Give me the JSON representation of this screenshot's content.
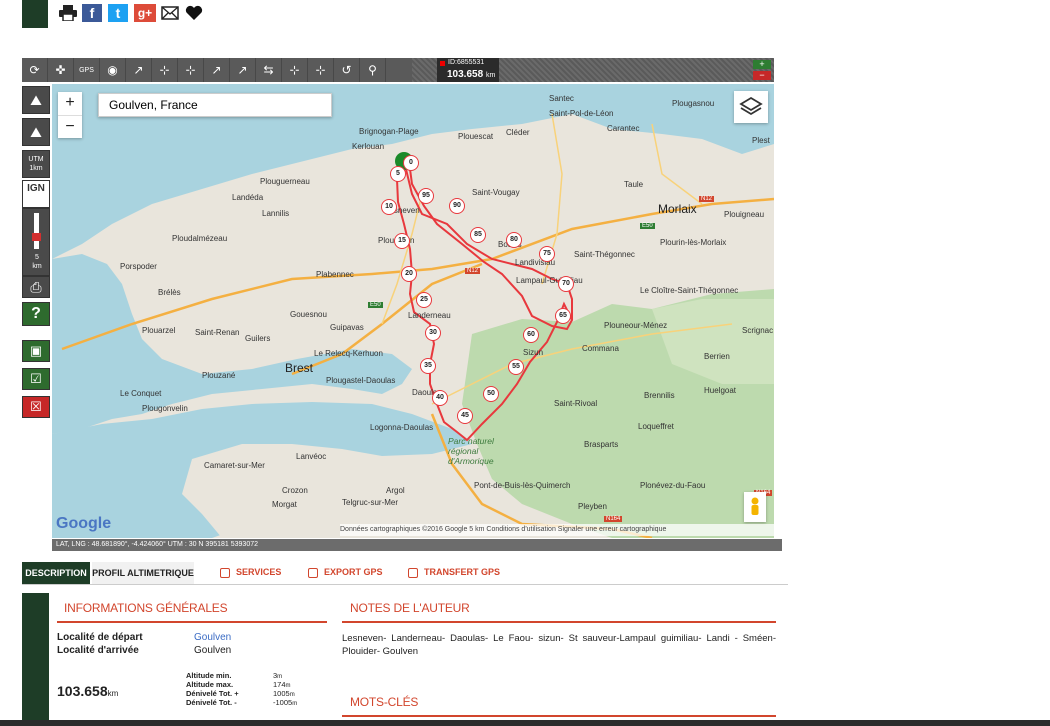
{
  "share": {
    "icons": [
      "print-icon",
      "facebook-icon",
      "twitter-icon",
      "googleplus-icon",
      "mail-icon",
      "heart-icon"
    ],
    "facebook": "f",
    "twitter": "t",
    "googleplus": "g+"
  },
  "toolbar": {
    "gps_label": "GPS",
    "route_id": "ID:6855531",
    "distance": "103.658",
    "distance_unit": "km"
  },
  "sidebar": {
    "utm_label": "UTM",
    "utm_scale": "1km",
    "ign_label": "IGN",
    "slider_scale": "5",
    "slider_unit": "km",
    "help": "?"
  },
  "map": {
    "search_value": "Goulven, France",
    "zoom_in": "+",
    "zoom_out": "−",
    "footer": "Données cartographiques ©2016 Google    5 km              Conditions d'utilisation    Signaler une erreur cartographique",
    "google": "Google",
    "coords": "LAT, LNG : 48.681890°, -4.424060°     UTM : 30 N  395181  5393072",
    "towns": [
      {
        "name": "Santec"
      },
      {
        "name": "Saint-Pol-de-Léon"
      },
      {
        "name": "Plougasnou"
      },
      {
        "name": "Carantec"
      },
      {
        "name": "Plest"
      },
      {
        "name": "Brignogan-Plage"
      },
      {
        "name": "Plouescat"
      },
      {
        "name": "Cléder"
      },
      {
        "name": "Kerlouan"
      },
      {
        "name": "Plouguerneau"
      },
      {
        "name": "Landéda"
      },
      {
        "name": "Lannilis"
      },
      {
        "name": "Saint-Vougay"
      },
      {
        "name": "Taule"
      },
      {
        "name": "Morlaix"
      },
      {
        "name": "Plouigneau"
      },
      {
        "name": "Ploudalmézeau"
      },
      {
        "name": "Plourin-lès-Morlaix"
      },
      {
        "name": "Saint-Thégonnec"
      },
      {
        "name": "Porspoder"
      },
      {
        "name": "Plabennec"
      },
      {
        "name": "Brélès"
      },
      {
        "name": "Le Cloître-Saint-Thégonnec"
      },
      {
        "name": "Gouesnou"
      },
      {
        "name": "Landerneau"
      },
      {
        "name": "Plouarzel"
      },
      {
        "name": "Saint-Renan"
      },
      {
        "name": "Guilers"
      },
      {
        "name": "Guipavas"
      },
      {
        "name": "Plouneour-Ménez"
      },
      {
        "name": "Scrignac"
      },
      {
        "name": "Le Relecq-Kerhuon"
      },
      {
        "name": "Commana"
      },
      {
        "name": "Berrien"
      },
      {
        "name": "Brest"
      },
      {
        "name": "Plougastel-Daoulas"
      },
      {
        "name": "Plouzané"
      },
      {
        "name": "Huelgoat"
      },
      {
        "name": "Le Conquet"
      },
      {
        "name": "Brennilis"
      },
      {
        "name": "Plougonvelin"
      },
      {
        "name": "Saint-Rivoal"
      },
      {
        "name": "Logonna-Daoulas"
      },
      {
        "name": "Loqueffret"
      },
      {
        "name": "Parc naturel régional d'Armorique"
      },
      {
        "name": "Brasparts"
      },
      {
        "name": "Lanvéoc"
      },
      {
        "name": "Camaret-sur-Mer"
      },
      {
        "name": "Pont-de-Buis-lès-Quimerch"
      },
      {
        "name": "Plonévez-du-Faou"
      },
      {
        "name": "Crozon"
      },
      {
        "name": "Argol"
      },
      {
        "name": "Morgat"
      },
      {
        "name": "Telgruc-sur-Mer"
      },
      {
        "name": "Pleyben"
      },
      {
        "name": "Lesneven"
      },
      {
        "name": "Landivisiau"
      },
      {
        "name": "Lampaul-Guimiliau"
      },
      {
        "name": "Sizun"
      },
      {
        "name": "Daoulas"
      },
      {
        "name": "Plouédern"
      },
      {
        "name": "Bodilis"
      }
    ],
    "road_labels": [
      "N12",
      "N12",
      "E50",
      "E50",
      "N164",
      "N164"
    ],
    "markers": [
      "0",
      "5",
      "10",
      "15",
      "20",
      "25",
      "30",
      "35",
      "40",
      "45",
      "50",
      "55",
      "60",
      "65",
      "70",
      "75",
      "80",
      "85",
      "90",
      "95"
    ]
  },
  "tabs": {
    "description": "DESCRIPTION",
    "profil": "PROFIL ALTIMETRIQUE",
    "services": "SERVICES",
    "export": "EXPORT GPS",
    "transfert": "TRANSFERT GPS"
  },
  "info": {
    "title": "INFORMATIONS GÉNÉRALES",
    "depart_label": "Localité de départ",
    "depart_value": "Goulven",
    "arrivee_label": "Localité d'arrivée",
    "arrivee_value": "Goulven",
    "distance": "103.658",
    "distance_unit": "km",
    "alt_min_label": "Altitude min.",
    "alt_min": "3",
    "alt_max_label": "Altitude max.",
    "alt_max": "174",
    "deniv_plus_label": "Dénivelé Tot. +",
    "deniv_plus": "1005",
    "deniv_minus_label": "Dénivelé Tot. -",
    "deniv_minus": "-1005",
    "unit_m": "m"
  },
  "notes": {
    "title": "NOTES DE L'AUTEUR",
    "text": "Lesneven- Landerneau- Daoulas- Le Faou- sizun- St sauveur-Lampaul guimiliau- Landi - Sméen- Plouider- Goulven",
    "keywords_title": "MOTS-CLÉS"
  },
  "colors": {
    "dark_green": "#1e3d27",
    "accent": "#d2462d",
    "route": "#e8383d",
    "sea": "#a9d3df",
    "land": "#e9e5dc",
    "forest": "#b8d8a8",
    "toolbar": "#5a5a5a"
  }
}
